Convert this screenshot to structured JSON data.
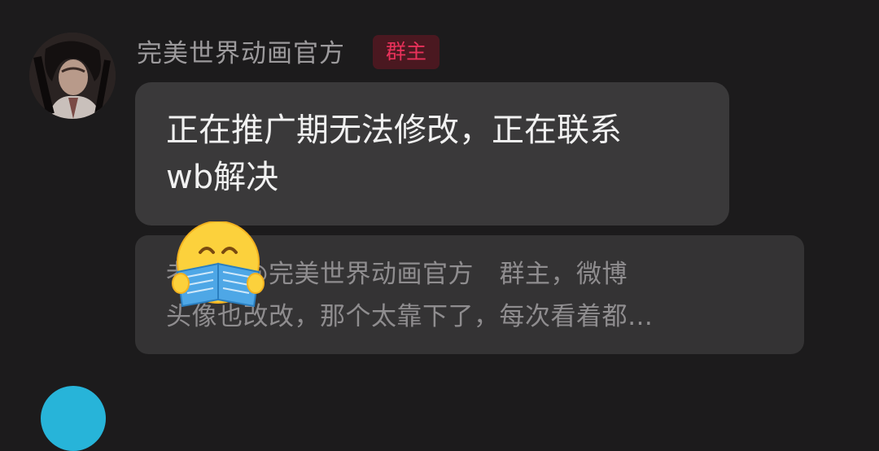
{
  "message": {
    "sender_name": "完美世界动画官方",
    "role_badge": "群主",
    "text": "正在推广期无法修改，正在联系\nwb解决",
    "reply_quote": "老哥：@完美世界动画官方　群主，微博\n头像也改改，那个太靠下了，每次看着都…"
  },
  "icons": {
    "avatar": "character-avatar",
    "emoji": "reading-book-emoji",
    "next_avatar": "next-sender-avatar"
  },
  "colors": {
    "background": "#1c1b1c",
    "bubble": "#3a393a",
    "badge_bg": "#4a1820",
    "badge_text": "#e8315a"
  }
}
